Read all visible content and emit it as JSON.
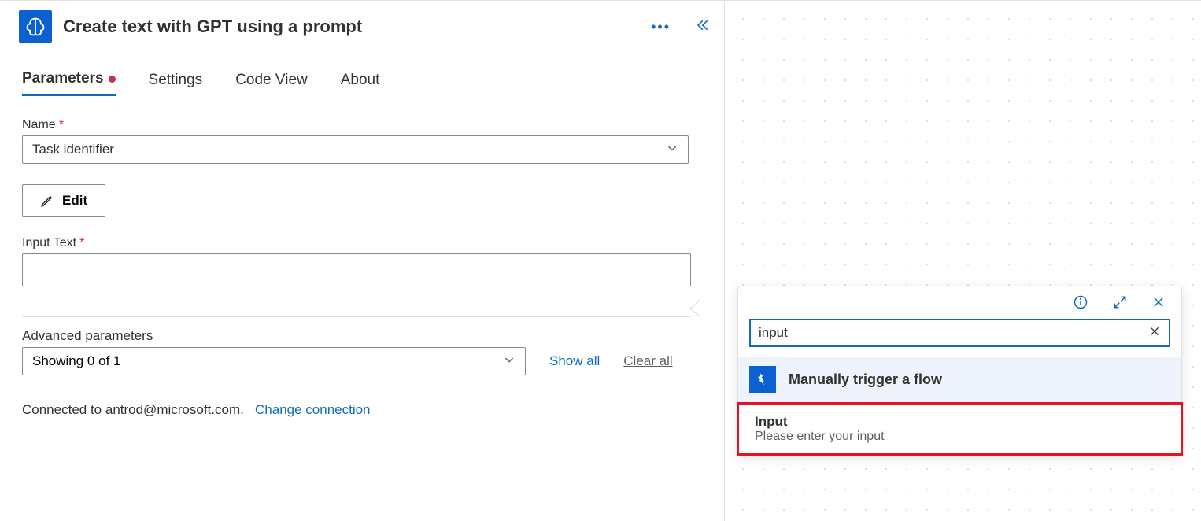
{
  "header": {
    "title": "Create text with GPT using a prompt"
  },
  "tabs": [
    "Parameters",
    "Settings",
    "Code View",
    "About"
  ],
  "fields": {
    "name_label": "Name",
    "name_value": "Task identifier",
    "edit_label": "Edit",
    "input_text_label": "Input Text",
    "input_text_value": ""
  },
  "advanced": {
    "section_label": "Advanced parameters",
    "selector_value": "Showing 0 of 1",
    "show_all": "Show all",
    "clear_all": "Clear all"
  },
  "connection": {
    "prefix": "Connected to ",
    "email": "antrod@microsoft.com.",
    "change_link": "Change connection"
  },
  "picker": {
    "search_value": "input",
    "trigger_title": "Manually trigger a flow",
    "item_title": "Input",
    "item_desc": "Please enter your input"
  }
}
